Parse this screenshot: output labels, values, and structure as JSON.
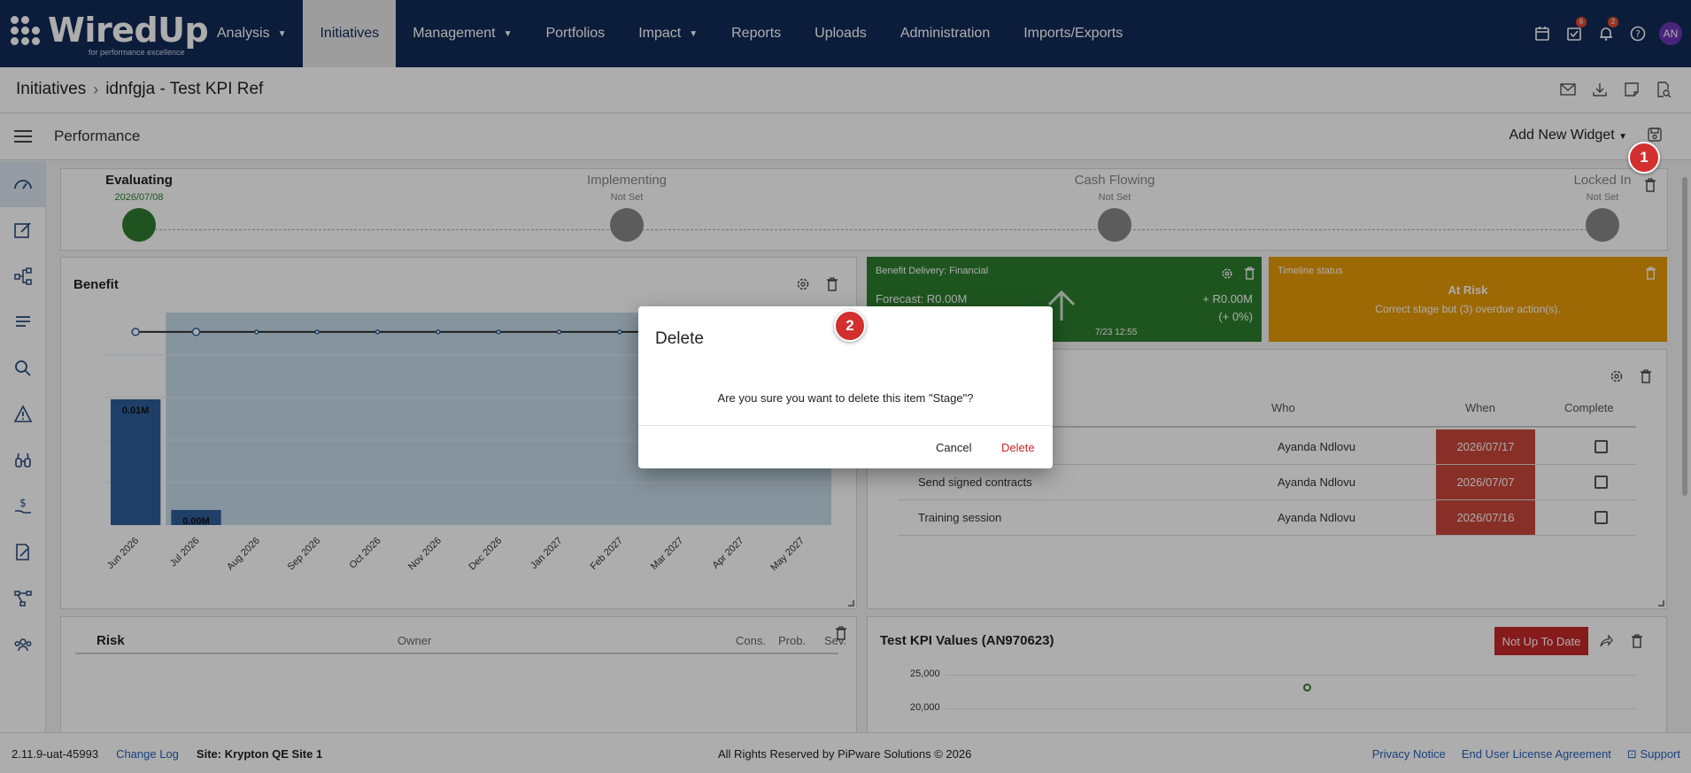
{
  "app": {
    "logo_text": "WiredUp",
    "logo_tagline": "for performance excellence"
  },
  "nav": {
    "items": [
      {
        "label": "Analysis",
        "dropdown": true
      },
      {
        "label": "Initiatives",
        "dropdown": false,
        "active": true
      },
      {
        "label": "Management",
        "dropdown": true
      },
      {
        "label": "Portfolios",
        "dropdown": false
      },
      {
        "label": "Impact",
        "dropdown": true
      },
      {
        "label": "Reports",
        "dropdown": false
      },
      {
        "label": "Uploads",
        "dropdown": false
      },
      {
        "label": "Administration",
        "dropdown": false
      },
      {
        "label": "Imports/Exports",
        "dropdown": false
      }
    ],
    "tasks_badge": "6",
    "notifications_badge": "2",
    "avatar_initials": "AN"
  },
  "breadcrumb": {
    "root": "Initiatives",
    "current": "idnfgja - Test KPI Ref"
  },
  "performance": {
    "title": "Performance",
    "add_widget_label": "Add New Widget"
  },
  "stages": [
    {
      "name": "Evaluating",
      "date": "2026/07/08",
      "done": true
    },
    {
      "name": "Implementing",
      "date": "Not Set",
      "done": false
    },
    {
      "name": "Cash Flowing",
      "date": "Not Set",
      "done": false
    },
    {
      "name": "Locked In",
      "date": "Not Set",
      "done": false
    }
  ],
  "benefit": {
    "title": "Benefit"
  },
  "chart_data": {
    "type": "bar",
    "categories": [
      "Jun 2026",
      "Jul 2026",
      "Aug 2026",
      "Sep 2026",
      "Oct 2026",
      "Nov 2026",
      "Dec 2026",
      "Jan 2027",
      "Feb 2027",
      "Mar 2027",
      "Apr 2027",
      "May 2027"
    ],
    "bar_values": [
      0.01,
      0.0012
    ],
    "bar_labels": [
      "0.01M",
      "0.00M"
    ],
    "line_values": [
      1,
      1,
      1,
      1,
      1,
      1,
      1,
      1,
      1,
      1,
      1,
      1
    ],
    "ylim": [
      0,
      1.1
    ],
    "bar_color": "#2d5f9a",
    "band_color": "#bcd3e4"
  },
  "benefit_delivery": {
    "title": "Benefit Delivery: Financial",
    "forecast": "Forecast: R0.00M",
    "delta": "+ R0.00M",
    "delta_pct": "(+ 0%)",
    "timestamp_partial": "7/23 12:55"
  },
  "timeline": {
    "title": "Timeline status",
    "status": "At Risk",
    "detail": "Correct stage but (3) overdue action(s)."
  },
  "actions": {
    "headers": {
      "who": "Who",
      "when": "When",
      "complete": "Complete"
    },
    "rows": [
      {
        "name": "",
        "who": "Ayanda Ndlovu",
        "when": "2026/07/17"
      },
      {
        "name": "Send signed contracts",
        "who": "Ayanda Ndlovu",
        "when": "2026/07/07"
      },
      {
        "name": "Training session",
        "who": "Ayanda Ndlovu",
        "when": "2026/07/16"
      }
    ]
  },
  "risk": {
    "title": "Risk",
    "headers": {
      "owner": "Owner",
      "cons": "Cons.",
      "prob": "Prob.",
      "sev": "Sev."
    }
  },
  "kpi": {
    "title": "Test KPI Values (AN970623)",
    "status_button": "Not Up To Date",
    "y_ticks": [
      "25,000",
      "20,000"
    ]
  },
  "footer": {
    "version": "2.11.9-uat-45993",
    "changelog": "Change Log",
    "site": "Site: Krypton QE Site 1",
    "copyright": "All Rights Reserved by PiPware Solutions © 2026",
    "privacy": "Privacy Notice",
    "eula": "End User License Agreement",
    "support": "Support"
  },
  "dialog": {
    "title": "Delete",
    "message": "Are you sure you want to delete this item \"Stage\"?",
    "cancel": "Cancel",
    "delete": "Delete"
  },
  "markers": [
    "1",
    "2"
  ]
}
